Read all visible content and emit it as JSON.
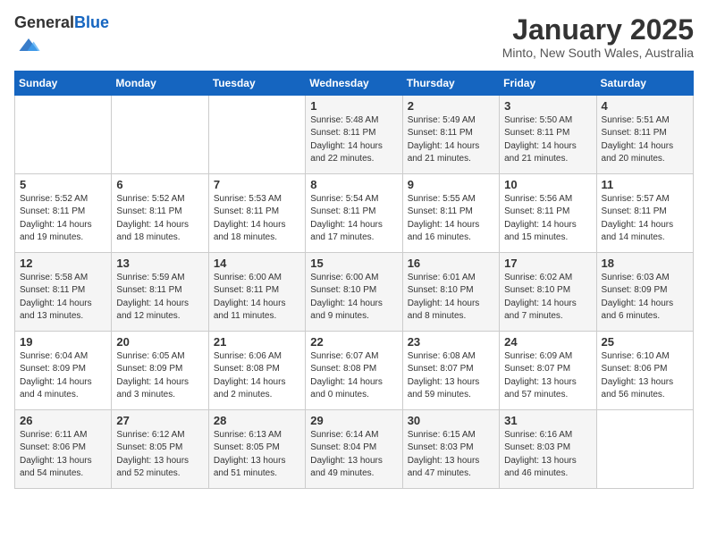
{
  "header": {
    "logo_general": "General",
    "logo_blue": "Blue",
    "month_title": "January 2025",
    "subtitle": "Minto, New South Wales, Australia"
  },
  "weekdays": [
    "Sunday",
    "Monday",
    "Tuesday",
    "Wednesday",
    "Thursday",
    "Friday",
    "Saturday"
  ],
  "weeks": [
    [
      {
        "day": "",
        "info": ""
      },
      {
        "day": "",
        "info": ""
      },
      {
        "day": "",
        "info": ""
      },
      {
        "day": "1",
        "info": "Sunrise: 5:48 AM\nSunset: 8:11 PM\nDaylight: 14 hours\nand 22 minutes."
      },
      {
        "day": "2",
        "info": "Sunrise: 5:49 AM\nSunset: 8:11 PM\nDaylight: 14 hours\nand 21 minutes."
      },
      {
        "day": "3",
        "info": "Sunrise: 5:50 AM\nSunset: 8:11 PM\nDaylight: 14 hours\nand 21 minutes."
      },
      {
        "day": "4",
        "info": "Sunrise: 5:51 AM\nSunset: 8:11 PM\nDaylight: 14 hours\nand 20 minutes."
      }
    ],
    [
      {
        "day": "5",
        "info": "Sunrise: 5:52 AM\nSunset: 8:11 PM\nDaylight: 14 hours\nand 19 minutes."
      },
      {
        "day": "6",
        "info": "Sunrise: 5:52 AM\nSunset: 8:11 PM\nDaylight: 14 hours\nand 18 minutes."
      },
      {
        "day": "7",
        "info": "Sunrise: 5:53 AM\nSunset: 8:11 PM\nDaylight: 14 hours\nand 18 minutes."
      },
      {
        "day": "8",
        "info": "Sunrise: 5:54 AM\nSunset: 8:11 PM\nDaylight: 14 hours\nand 17 minutes."
      },
      {
        "day": "9",
        "info": "Sunrise: 5:55 AM\nSunset: 8:11 PM\nDaylight: 14 hours\nand 16 minutes."
      },
      {
        "day": "10",
        "info": "Sunrise: 5:56 AM\nSunset: 8:11 PM\nDaylight: 14 hours\nand 15 minutes."
      },
      {
        "day": "11",
        "info": "Sunrise: 5:57 AM\nSunset: 8:11 PM\nDaylight: 14 hours\nand 14 minutes."
      }
    ],
    [
      {
        "day": "12",
        "info": "Sunrise: 5:58 AM\nSunset: 8:11 PM\nDaylight: 14 hours\nand 13 minutes."
      },
      {
        "day": "13",
        "info": "Sunrise: 5:59 AM\nSunset: 8:11 PM\nDaylight: 14 hours\nand 12 minutes."
      },
      {
        "day": "14",
        "info": "Sunrise: 6:00 AM\nSunset: 8:11 PM\nDaylight: 14 hours\nand 11 minutes."
      },
      {
        "day": "15",
        "info": "Sunrise: 6:00 AM\nSunset: 8:10 PM\nDaylight: 14 hours\nand 9 minutes."
      },
      {
        "day": "16",
        "info": "Sunrise: 6:01 AM\nSunset: 8:10 PM\nDaylight: 14 hours\nand 8 minutes."
      },
      {
        "day": "17",
        "info": "Sunrise: 6:02 AM\nSunset: 8:10 PM\nDaylight: 14 hours\nand 7 minutes."
      },
      {
        "day": "18",
        "info": "Sunrise: 6:03 AM\nSunset: 8:09 PM\nDaylight: 14 hours\nand 6 minutes."
      }
    ],
    [
      {
        "day": "19",
        "info": "Sunrise: 6:04 AM\nSunset: 8:09 PM\nDaylight: 14 hours\nand 4 minutes."
      },
      {
        "day": "20",
        "info": "Sunrise: 6:05 AM\nSunset: 8:09 PM\nDaylight: 14 hours\nand 3 minutes."
      },
      {
        "day": "21",
        "info": "Sunrise: 6:06 AM\nSunset: 8:08 PM\nDaylight: 14 hours\nand 2 minutes."
      },
      {
        "day": "22",
        "info": "Sunrise: 6:07 AM\nSunset: 8:08 PM\nDaylight: 14 hours\nand 0 minutes."
      },
      {
        "day": "23",
        "info": "Sunrise: 6:08 AM\nSunset: 8:07 PM\nDaylight: 13 hours\nand 59 minutes."
      },
      {
        "day": "24",
        "info": "Sunrise: 6:09 AM\nSunset: 8:07 PM\nDaylight: 13 hours\nand 57 minutes."
      },
      {
        "day": "25",
        "info": "Sunrise: 6:10 AM\nSunset: 8:06 PM\nDaylight: 13 hours\nand 56 minutes."
      }
    ],
    [
      {
        "day": "26",
        "info": "Sunrise: 6:11 AM\nSunset: 8:06 PM\nDaylight: 13 hours\nand 54 minutes."
      },
      {
        "day": "27",
        "info": "Sunrise: 6:12 AM\nSunset: 8:05 PM\nDaylight: 13 hours\nand 52 minutes."
      },
      {
        "day": "28",
        "info": "Sunrise: 6:13 AM\nSunset: 8:05 PM\nDaylight: 13 hours\nand 51 minutes."
      },
      {
        "day": "29",
        "info": "Sunrise: 6:14 AM\nSunset: 8:04 PM\nDaylight: 13 hours\nand 49 minutes."
      },
      {
        "day": "30",
        "info": "Sunrise: 6:15 AM\nSunset: 8:03 PM\nDaylight: 13 hours\nand 47 minutes."
      },
      {
        "day": "31",
        "info": "Sunrise: 6:16 AM\nSunset: 8:03 PM\nDaylight: 13 hours\nand 46 minutes."
      },
      {
        "day": "",
        "info": ""
      }
    ]
  ]
}
